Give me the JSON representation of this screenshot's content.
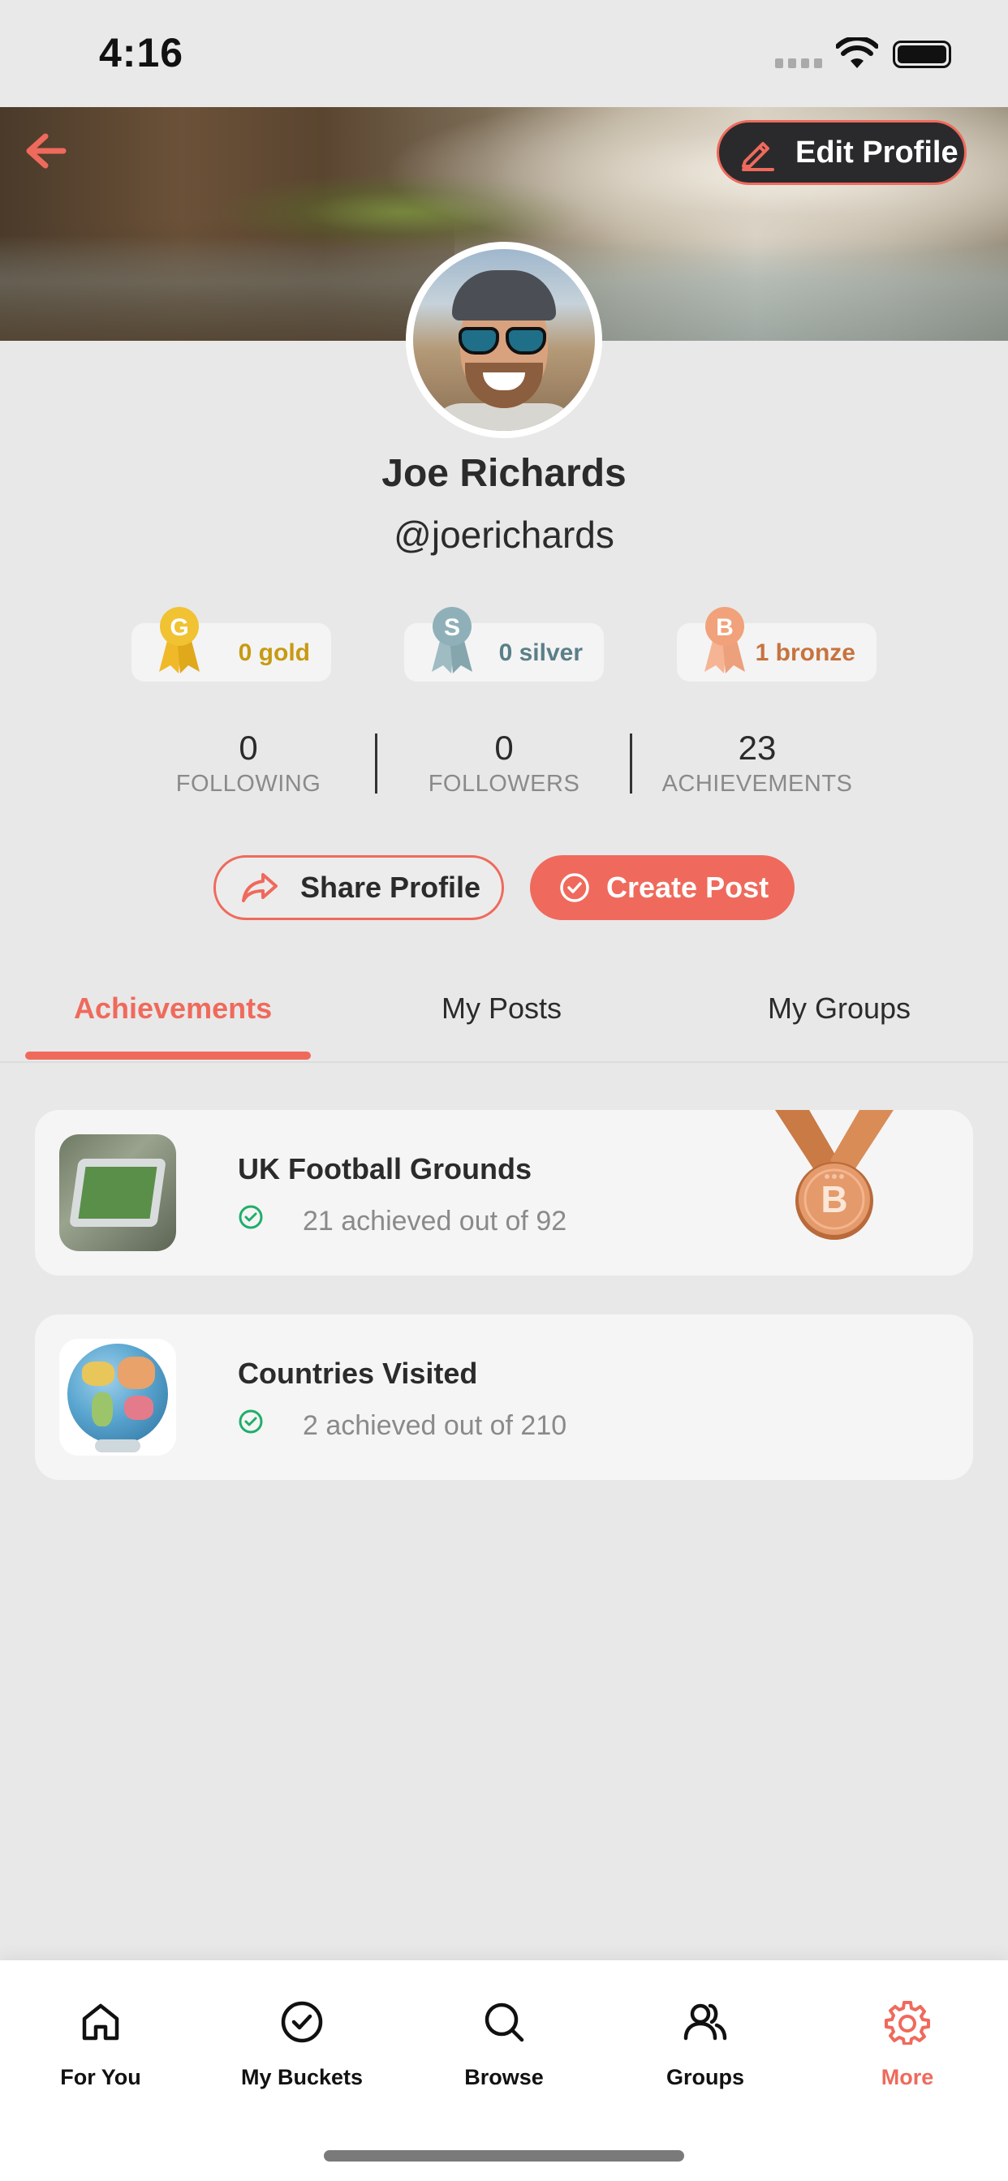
{
  "status_bar": {
    "time": "4:16"
  },
  "header": {
    "edit_profile_label": "Edit Profile"
  },
  "profile": {
    "name": "Joe Richards",
    "handle": "@joerichards"
  },
  "medals": [
    {
      "letter": "G",
      "count_label": "0 gold",
      "color": "#c79a12",
      "ribbon_color": "#f0b92a"
    },
    {
      "letter": "S",
      "count_label": "0 silver",
      "color": "#5a7f88",
      "ribbon_color": "#8fb0b8"
    },
    {
      "letter": "B",
      "count_label": "1 bronze",
      "color": "#c7733f",
      "ribbon_color": "#f1a27a"
    }
  ],
  "stats": [
    {
      "value": "0",
      "label": "FOLLOWING"
    },
    {
      "value": "0",
      "label": "FOLLOWERS"
    },
    {
      "value": "23",
      "label": "ACHIEVEMENTS"
    }
  ],
  "actions": {
    "share_label": "Share Profile",
    "create_label": "Create Post"
  },
  "tabs": [
    {
      "label": "Achievements",
      "active": true
    },
    {
      "label": "My Posts",
      "active": false
    },
    {
      "label": "My Groups",
      "active": false
    }
  ],
  "achievements": [
    {
      "title": "UK Football Grounds",
      "progress": "21 achieved out of 92",
      "medal": "B"
    },
    {
      "title": "Countries Visited",
      "progress": "2 achieved out of 210"
    }
  ],
  "bottom_nav": [
    {
      "label": "For You",
      "icon": "home-icon",
      "active": false
    },
    {
      "label": "My Buckets",
      "icon": "check-circle-icon",
      "active": false
    },
    {
      "label": "Browse",
      "icon": "search-icon",
      "active": false
    },
    {
      "label": "Groups",
      "icon": "users-icon",
      "active": false
    },
    {
      "label": "More",
      "icon": "gear-icon",
      "active": true
    }
  ],
  "colors": {
    "accent": "#ef6a5c",
    "success": "#1fae6a",
    "dark": "#2a2a2c"
  }
}
